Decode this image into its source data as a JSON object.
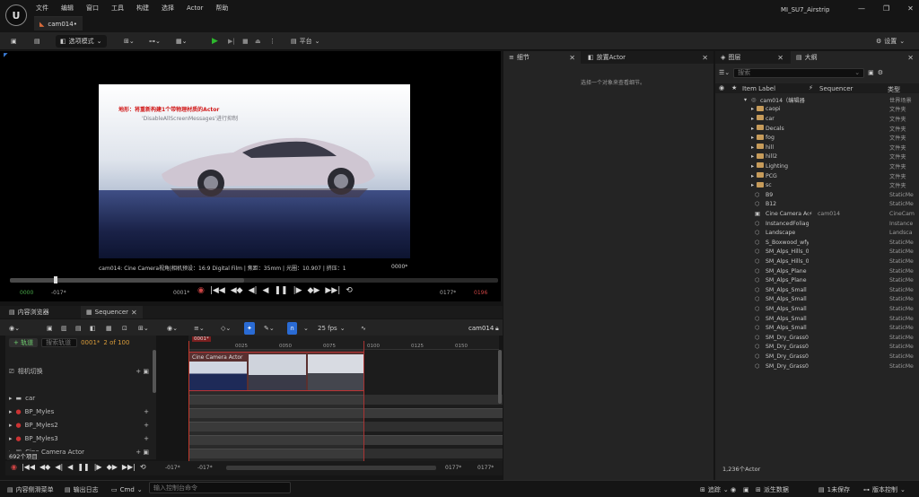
{
  "menu": [
    "文件",
    "编辑",
    "窗口",
    "工具",
    "构建",
    "选择",
    "Actor",
    "帮助"
  ],
  "map_title": "MI_SU7_Airstrip",
  "doc_tab": "cam014•",
  "toolbar": {
    "mode_label": "选项模式",
    "platform_label": "平台",
    "settings_label": "设置"
  },
  "viewport": {
    "overlay_red": "地形：将重新构建1个带物理材质的Actor",
    "overlay_grey": "'DisableAllScreenMessages'进行抑制",
    "camera_info": "cam014: Cine Camera视角|相机预设：16:9 Digital Film | 焦距：35mm | 光圈：10.907 | 挤压：1",
    "frame": "0000*"
  },
  "transport": {
    "start": "0000",
    "in": "-017*",
    "current": "0001*",
    "out": "0177*",
    "end": "0196"
  },
  "panels": {
    "content_browser": "内容浏览器",
    "sequencer": "Sequencer",
    "details": "细节",
    "place_actor": "放置Actor",
    "layers": "图层",
    "outliner": "大纲"
  },
  "sequencer": {
    "fps": "25 fps",
    "seq_name": "cam014",
    "add_track": "+ 轨道",
    "search_placeholder": "搜索轨道",
    "frame_field": "0001*",
    "count": "2 of 100",
    "playhead_label": "0001*",
    "ticks": [
      "0025",
      "0050",
      "0075",
      "0100",
      "0125",
      "0150"
    ],
    "tracks": [
      "相机切换",
      "car",
      "BP_Myles",
      "BP_Myles2",
      "BP_Myles3",
      "Cine Camera Actor"
    ],
    "clip_label": "Cine Camera Actor",
    "bottom_left": [
      "-017*",
      "-017*"
    ],
    "bottom_right": [
      "0177*",
      "0177*"
    ],
    "items_badge": "692个项目"
  },
  "details": {
    "empty_message": "选择一个对象来查看细节。"
  },
  "outliner": {
    "search_placeholder": "搜索",
    "col_label": "Item Label",
    "col_seq": "Sequencer",
    "col_type": "类型",
    "root": "cam014（编辑器",
    "root_type": "世界场景",
    "rows": [
      {
        "name": "caopi",
        "type": "文件夹",
        "kind": "folder",
        "seq": ""
      },
      {
        "name": "car",
        "type": "文件夹",
        "kind": "folder",
        "seq": ""
      },
      {
        "name": "Decals",
        "type": "文件夹",
        "kind": "folder",
        "seq": ""
      },
      {
        "name": "fog",
        "type": "文件夹",
        "kind": "folder",
        "seq": ""
      },
      {
        "name": "hill",
        "type": "文件夹",
        "kind": "folder",
        "seq": ""
      },
      {
        "name": "hill2",
        "type": "文件夹",
        "kind": "folder",
        "seq": ""
      },
      {
        "name": "Lighting",
        "type": "文件夹",
        "kind": "folder",
        "seq": ""
      },
      {
        "name": "PCG",
        "type": "文件夹",
        "kind": "folder",
        "seq": ""
      },
      {
        "name": "sc",
        "type": "文件夹",
        "kind": "folder",
        "seq": ""
      },
      {
        "name": "B9",
        "type": "StaticMe",
        "kind": "mesh",
        "seq": ""
      },
      {
        "name": "B12",
        "type": "StaticMe",
        "kind": "mesh",
        "seq": ""
      },
      {
        "name": "Cine Camera Ac",
        "type": "CineCam",
        "kind": "camera",
        "seq": "cam014"
      },
      {
        "name": "InstancedFoliag",
        "type": "Instance",
        "kind": "mesh",
        "seq": ""
      },
      {
        "name": "Landscape",
        "type": "Landsca",
        "kind": "mesh",
        "seq": ""
      },
      {
        "name": "S_Boxwood_wfy",
        "type": "StaticMe",
        "kind": "mesh",
        "seq": ""
      },
      {
        "name": "SM_Alps_Hills_0",
        "type": "StaticMe",
        "kind": "mesh",
        "seq": ""
      },
      {
        "name": "SM_Alps_Hills_0",
        "type": "StaticMe",
        "kind": "mesh",
        "seq": ""
      },
      {
        "name": "SM_Alps_Plane",
        "type": "StaticMe",
        "kind": "mesh",
        "seq": ""
      },
      {
        "name": "SM_Alps_Plane",
        "type": "StaticMe",
        "kind": "mesh",
        "seq": ""
      },
      {
        "name": "SM_Alps_Small",
        "type": "StaticMe",
        "kind": "mesh",
        "seq": ""
      },
      {
        "name": "SM_Alps_Small",
        "type": "StaticMe",
        "kind": "mesh",
        "seq": ""
      },
      {
        "name": "SM_Alps_Small",
        "type": "StaticMe",
        "kind": "mesh",
        "seq": ""
      },
      {
        "name": "SM_Alps_Small",
        "type": "StaticMe",
        "kind": "mesh",
        "seq": ""
      },
      {
        "name": "SM_Alps_Small",
        "type": "StaticMe",
        "kind": "mesh",
        "seq": ""
      },
      {
        "name": "SM_Dry_Grass0",
        "type": "StaticMe",
        "kind": "mesh",
        "seq": ""
      },
      {
        "name": "SM_Dry_Grass0",
        "type": "StaticMe",
        "kind": "mesh",
        "seq": ""
      },
      {
        "name": "SM_Dry_Grass0",
        "type": "StaticMe",
        "kind": "mesh",
        "seq": ""
      },
      {
        "name": "SM_Dry_Grass0",
        "type": "StaticMe",
        "kind": "mesh",
        "seq": ""
      }
    ],
    "count": "1,236个Actor"
  },
  "statusbar": {
    "content_drawer": "内容侧滑菜单",
    "output_log": "输出日志",
    "cmd": "Cmd",
    "cmd_placeholder": "输入控制台命令",
    "trace": "追踪",
    "derived_data": "派生数据",
    "unsaved": "1未保存",
    "source_control": "版本控制"
  }
}
